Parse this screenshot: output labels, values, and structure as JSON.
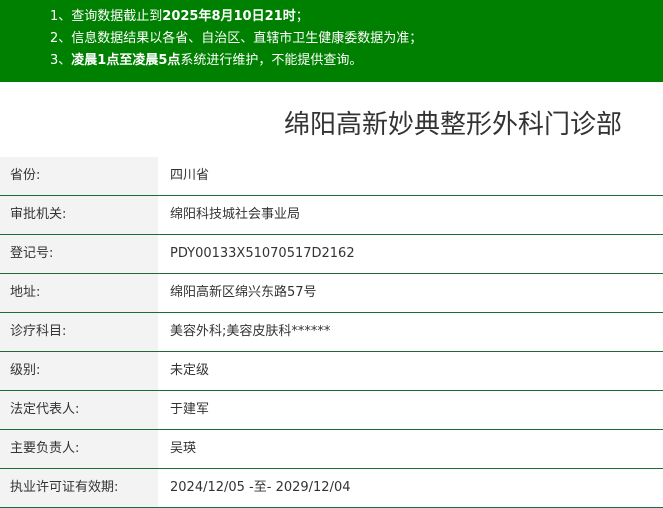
{
  "notice": {
    "line1": {
      "prefix": "1、查询数据截止到",
      "emph": "2025年8月10日21时",
      "suffix": "；"
    },
    "line2": {
      "text": "2、信息数据结果以各省、自治区、直辖市卫生健康委数据为准；"
    },
    "line3": {
      "prefix": "3、",
      "emph1": "凌晨1点至凌晨5点",
      "suffix": "系统进行维护，不能提供查询。"
    }
  },
  "title": "绵阳高新妙典整形外科门诊部",
  "fields": [
    {
      "label": "省份:",
      "value": "四川省"
    },
    {
      "label": "审批机关:",
      "value": "绵阳科技城社会事业局"
    },
    {
      "label": "登记号:",
      "value": "PDY00133X51070517D2162"
    },
    {
      "label": "地址:",
      "value": "绵阳高新区绵兴东路57号"
    },
    {
      "label": "诊疗科目:",
      "value": "美容外科;美容皮肤科******"
    },
    {
      "label": "级别:",
      "value": "未定级"
    },
    {
      "label": "法定代表人:",
      "value": "于建军"
    },
    {
      "label": "主要负责人:",
      "value": "吴瑛"
    },
    {
      "label": "执业许可证有效期:",
      "value": "2024/12/05 -至- 2029/12/04"
    }
  ],
  "colors": {
    "notice_bg": "#008000",
    "row_border": "#1d6b3a",
    "label_bg": "#f3f3f3"
  }
}
